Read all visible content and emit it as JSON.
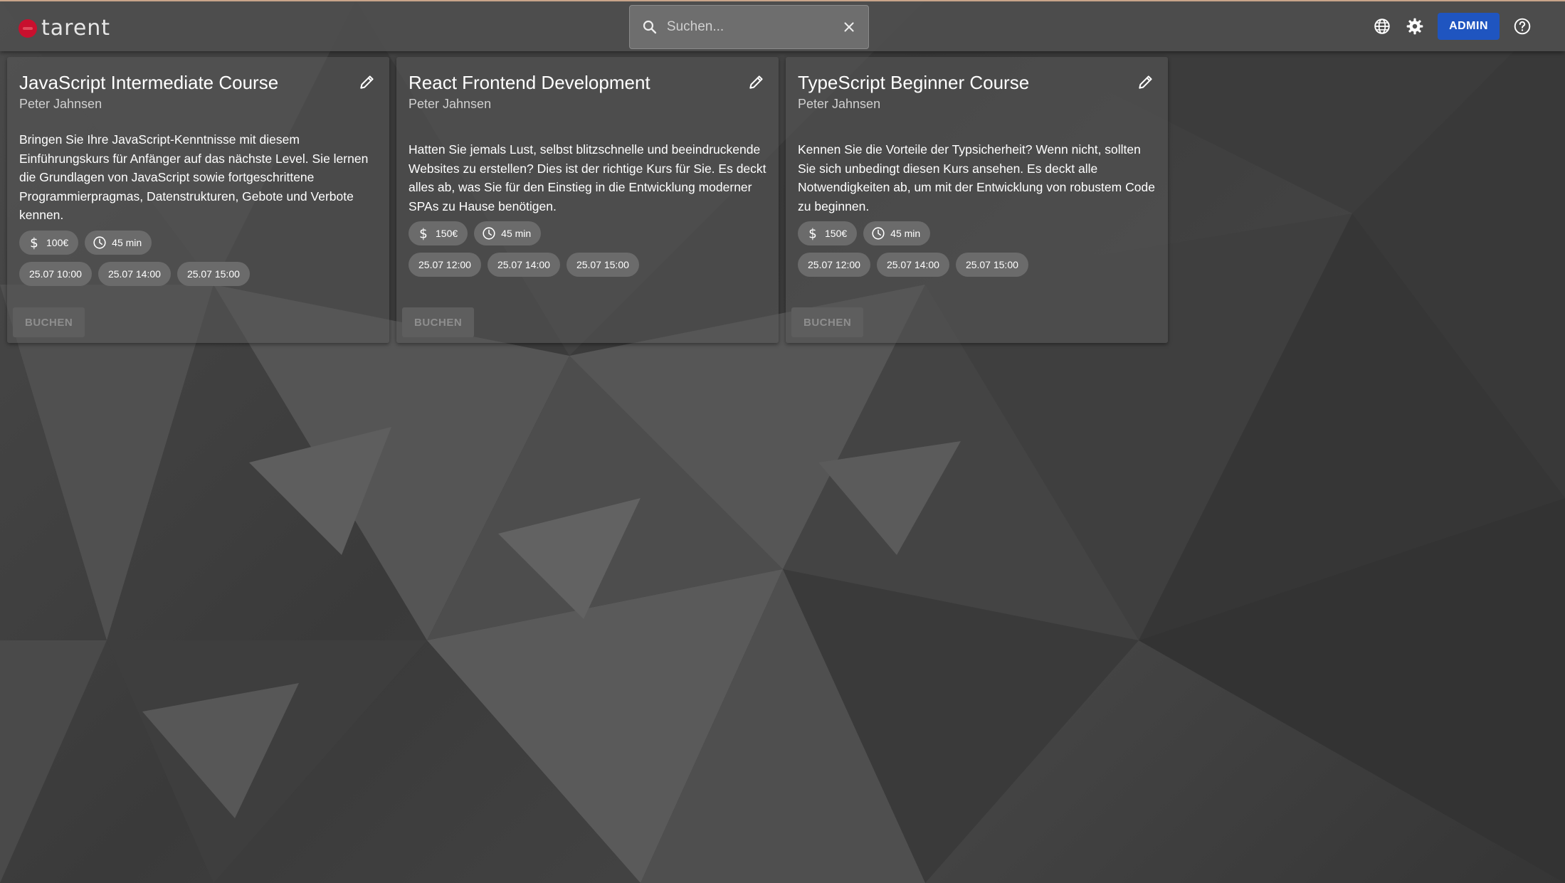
{
  "header": {
    "logo_text": "tarent",
    "search": {
      "placeholder": "Suchen...",
      "value": ""
    },
    "admin_label": "ADMIN"
  },
  "courses": [
    {
      "title": "JavaScript Intermediate Course",
      "author": "Peter Jahnsen",
      "description": "Bringen Sie Ihre JavaScript-Kenntnisse mit diesem Einführungskurs für Anfänger auf das nächste Level. Sie lernen die Grundlagen von JavaScript sowie fortgeschrittene Programmierpragmas, Datenstrukturen, Gebote und Verbote kennen.",
      "price": "100€",
      "duration": "45 min",
      "dates": [
        "25.07 10:00",
        "25.07 14:00",
        "25.07 15:00"
      ],
      "book_label": "BUCHEN"
    },
    {
      "title": "React Frontend Development",
      "author": "Peter Jahnsen",
      "description": "Hatten Sie jemals Lust, selbst blitzschnelle und beeindruckende Websites zu erstellen? Dies ist der richtige Kurs für Sie. Es deckt alles ab, was Sie für den Einstieg in die Entwicklung moderner SPAs zu Hause benötigen.",
      "price": "150€",
      "duration": "45 min",
      "dates": [
        "25.07 12:00",
        "25.07 14:00",
        "25.07 15:00"
      ],
      "book_label": "BUCHEN"
    },
    {
      "title": "TypeScript Beginner Course",
      "author": "Peter Jahnsen",
      "description": "Kennen Sie die Vorteile der Typsicherheit? Wenn nicht, sollten Sie sich unbedingt diesen Kurs ansehen. Es deckt alle Notwendigkeiten ab, um mit der Entwicklung von robustem Code zu beginnen.",
      "price": "150€",
      "duration": "45 min",
      "dates": [
        "25.07 12:00",
        "25.07 14:00",
        "25.07 15:00"
      ],
      "book_label": "BUCHEN"
    }
  ],
  "colors": {
    "accent": "#1f55c0",
    "logo": "#c8102e"
  },
  "icons": [
    "search-icon",
    "close-icon",
    "globe-icon",
    "gear-icon",
    "help-icon",
    "edit-icon",
    "dollar-icon",
    "clock-icon"
  ]
}
